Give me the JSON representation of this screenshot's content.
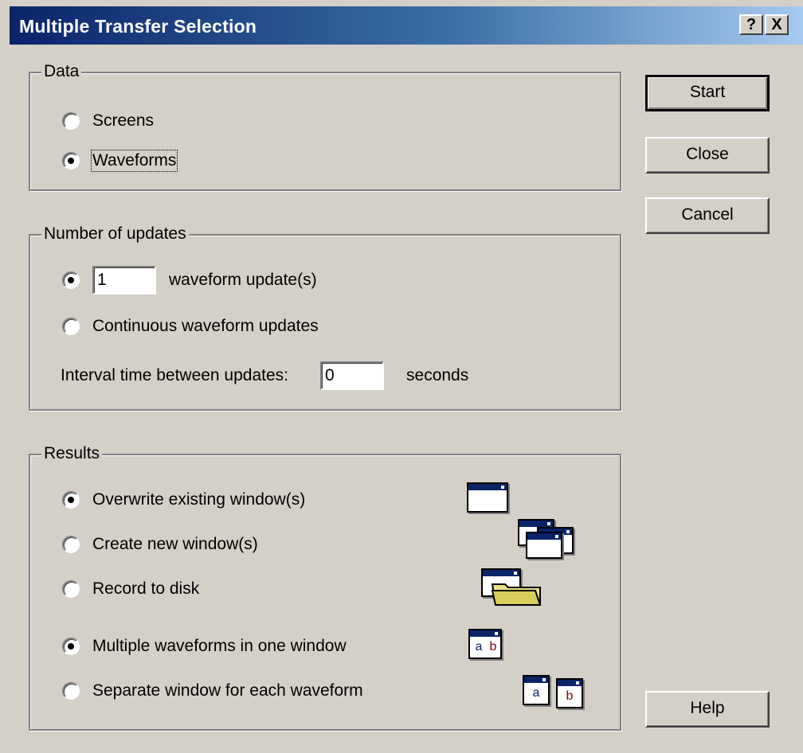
{
  "window": {
    "title": "Multiple Transfer Selection",
    "help_label": "?",
    "close_label": "X"
  },
  "data_group": {
    "legend": "Data",
    "options": [
      {
        "label": "Screens",
        "selected": false
      },
      {
        "label": "Waveforms",
        "selected": true
      }
    ]
  },
  "updates_group": {
    "legend": "Number of updates",
    "count_value": "1",
    "count_suffix": "waveform update(s)",
    "count_selected": true,
    "continuous_label": "Continuous waveform updates",
    "continuous_selected": false,
    "interval_label": "Interval time between updates:",
    "interval_value": "0",
    "interval_unit": "seconds"
  },
  "results_group": {
    "legend": "Results",
    "options": [
      {
        "label": "Overwrite existing window(s)",
        "selected": true,
        "icon": "single-window-icon"
      },
      {
        "label": "Create new window(s)",
        "selected": false,
        "icon": "multiple-windows-icon"
      },
      {
        "label": "Record to disk",
        "selected": false,
        "icon": "folder-window-icon"
      },
      {
        "label": "Multiple waveforms in one window",
        "selected": true,
        "icon": "combined-ab-window-icon"
      },
      {
        "label": "Separate window for each waveform",
        "selected": false,
        "icon": "separate-ab-windows-icon"
      }
    ],
    "letters": {
      "a": "a",
      "b": "b"
    }
  },
  "buttons": {
    "start": "Start",
    "close": "Close",
    "cancel": "Cancel",
    "help": "Help"
  }
}
